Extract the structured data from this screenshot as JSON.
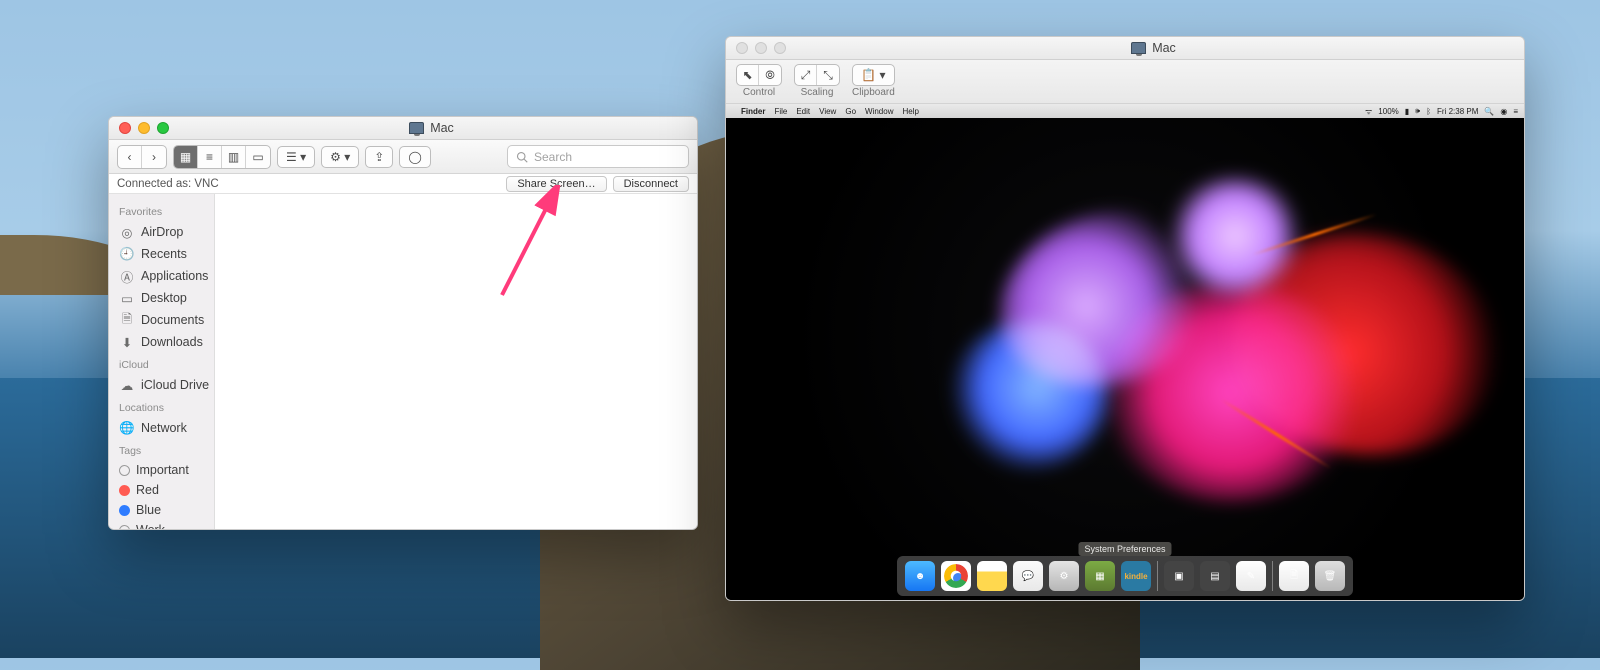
{
  "finder": {
    "title": "Mac",
    "search_placeholder": "Search",
    "connected_label": "Connected as: VNC",
    "share_button": "Share Screen…",
    "disconnect_button": "Disconnect",
    "sidebar": {
      "favorites_label": "Favorites",
      "favorites": [
        "AirDrop",
        "Recents",
        "Applications",
        "Desktop",
        "Documents",
        "Downloads"
      ],
      "icloud_label": "iCloud",
      "icloud": [
        "iCloud Drive"
      ],
      "locations_label": "Locations",
      "locations": [
        "Network"
      ],
      "tags_label": "Tags",
      "tags": [
        "Important",
        "Red",
        "Blue",
        "Work"
      ]
    }
  },
  "screenshare": {
    "title": "Mac",
    "groups": {
      "control": "Control",
      "scaling": "Scaling",
      "clipboard": "Clipboard"
    },
    "remote": {
      "menubar": [
        "Finder",
        "File",
        "Edit",
        "View",
        "Go",
        "Window",
        "Help"
      ],
      "battery": "100%",
      "time": "Fri 2:38 PM",
      "tooltip": "System Preferences",
      "dock": [
        "Finder",
        "Chrome",
        "Notes",
        "Messages",
        "System Preferences",
        "Minecraft",
        "Kindle",
        "App",
        "App",
        "TextEdit",
        "Trash"
      ]
    }
  }
}
